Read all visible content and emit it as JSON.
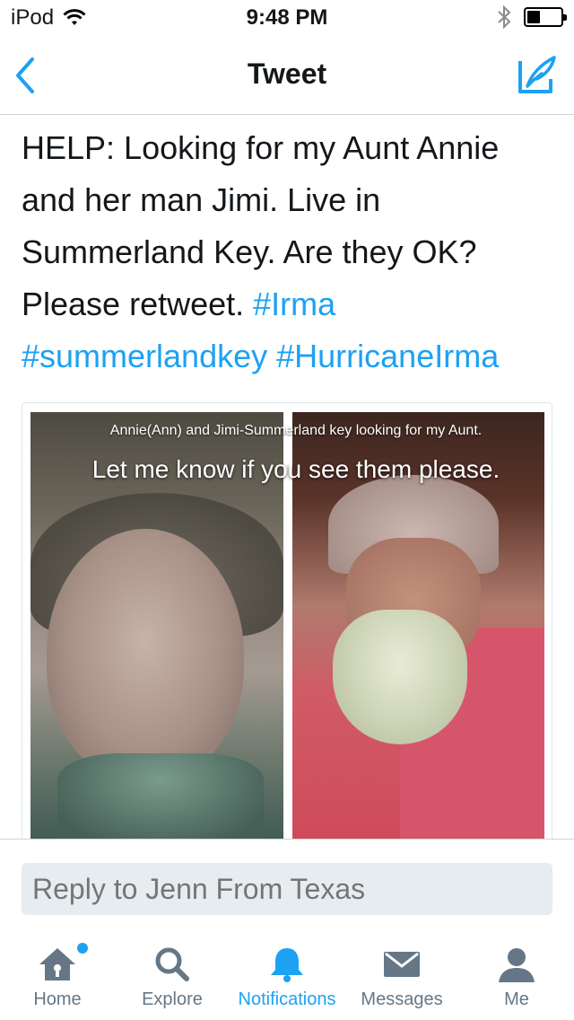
{
  "status_bar": {
    "carrier": "iPod",
    "time": "9:48 PM",
    "battery_percent": 40
  },
  "nav": {
    "title": "Tweet",
    "back_icon": "chevron-left-icon",
    "compose_icon": "compose-icon"
  },
  "tweet": {
    "text_plain": "HELP: Looking for my Aunt Annie and her man Jimi. Live in Summerland Key. Are they OK? Please retweet.",
    "hashtags": [
      "#Irma",
      "#summerlandkey",
      "#HurricaneIrma"
    ],
    "media": {
      "caption_line1": "Annie(Ann) and Jimi-Summerland key looking for my Aunt.",
      "caption_line2": "Let me know if you see them please."
    }
  },
  "reply": {
    "placeholder": "Reply to Jenn From Texas"
  },
  "tab_bar": {
    "tabs": [
      {
        "label": "Home",
        "icon": "home-icon",
        "active": false
      },
      {
        "label": "Explore",
        "icon": "search-icon",
        "active": false
      },
      {
        "label": "Notifications",
        "icon": "bell-icon",
        "active": true
      },
      {
        "label": "Messages",
        "icon": "envelope-icon",
        "active": false
      },
      {
        "label": "Me",
        "icon": "person-icon",
        "active": false
      }
    ]
  },
  "colors": {
    "accent": "#1da1f2",
    "text": "#14171a",
    "muted": "#657786",
    "icon_gray": "#657786"
  }
}
